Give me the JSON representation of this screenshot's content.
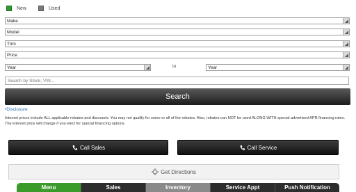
{
  "condition": {
    "new_label": "New",
    "used_label": "Used"
  },
  "filters": {
    "make": "Make",
    "model": "Model",
    "trim": "Trim",
    "price": "Price",
    "year_from": "Year",
    "year_sep": "to",
    "year_to": "Year"
  },
  "search": {
    "placeholder": "Search by Stock, VIN...",
    "button_label": "Search"
  },
  "disclosure": {
    "link": "•Disclosure",
    "text": "Internet prices include ALL applicable rebates and discounts. You may not qualify for some or all of the rebates. Also, rebates can NOT be used ALONG WITH special advertised APR financing rates. The internet price will change if you elect for special financing options."
  },
  "actions": {
    "call_sales": "Call Sales",
    "call_service": "Call Service",
    "get_directions": "Get Directions"
  },
  "tabs": [
    "Menu",
    "Sales",
    "Inventory",
    "Service Appt",
    "Push Notification"
  ],
  "colors": {
    "menu_tab": "#3a9b2a",
    "active_tab": "#8a8a8a",
    "link": "#2f6fb7"
  },
  "icons": {
    "phone": "phone-icon",
    "directions": "crosshair-icon"
  }
}
